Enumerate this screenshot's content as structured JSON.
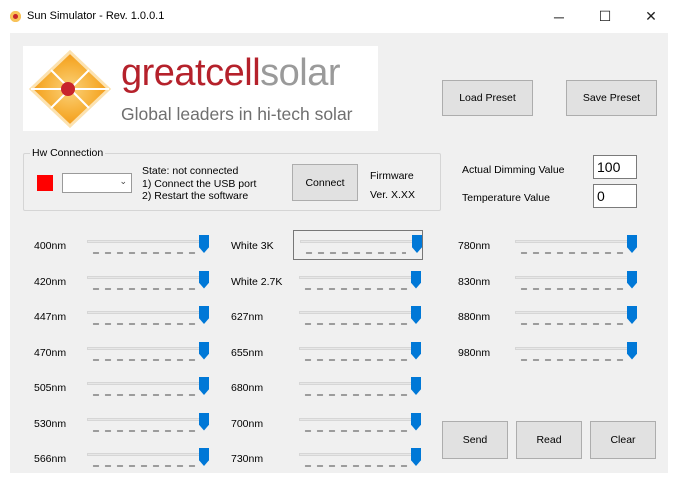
{
  "window": {
    "title": "Sun Simulator - Rev. 1.0.0.1",
    "minimize": "─",
    "maximize": "☐",
    "close": "✕"
  },
  "logo": {
    "word_part1": "greatcell",
    "word_part2": "solar",
    "tagline": "Global leaders in hi-tech solar",
    "colors": {
      "red": "#b5212b",
      "orange": "#f4a623",
      "grey": "#9a9a9a"
    }
  },
  "toolbar": {
    "load_preset": "Load Preset",
    "save_preset": "Save Preset"
  },
  "hw": {
    "group_label": "Hw Connection",
    "status_color": "#ff0000",
    "port_value": "",
    "state_line1": "State: not connected",
    "state_line2": "1) Connect the USB port",
    "state_line3": "2) Restart the software",
    "connect_label": "Connect",
    "firmware_label": "Firmware",
    "firmware_version": "Ver. X.XX"
  },
  "dimming": {
    "label": "Actual Dimming Value",
    "value": "100"
  },
  "temperature": {
    "label": "Temperature Value",
    "value": "0"
  },
  "channels": {
    "col1": [
      {
        "label": "400nm",
        "level": 1.0
      },
      {
        "label": "420nm",
        "level": 1.0
      },
      {
        "label": "447nm",
        "level": 1.0
      },
      {
        "label": "470nm",
        "level": 1.0
      },
      {
        "label": "505nm",
        "level": 1.0
      },
      {
        "label": "530nm",
        "level": 1.0
      },
      {
        "label": "566nm",
        "level": 1.0
      }
    ],
    "col2": [
      {
        "label": "White 3K",
        "level": 1.0
      },
      {
        "label": "White 2.7K",
        "level": 1.0
      },
      {
        "label": "627nm",
        "level": 1.0
      },
      {
        "label": "655nm",
        "level": 1.0
      },
      {
        "label": "680nm",
        "level": 1.0
      },
      {
        "label": "700nm",
        "level": 1.0
      },
      {
        "label": "730nm",
        "level": 1.0
      }
    ],
    "col3": [
      {
        "label": "780nm",
        "level": 1.0
      },
      {
        "label": "830nm",
        "level": 1.0
      },
      {
        "label": "880nm",
        "level": 1.0
      },
      {
        "label": "980nm",
        "level": 1.0
      }
    ]
  },
  "actions": {
    "send": "Send",
    "read": "Read",
    "clear": "Clear"
  },
  "accent_color": "#0078d7"
}
